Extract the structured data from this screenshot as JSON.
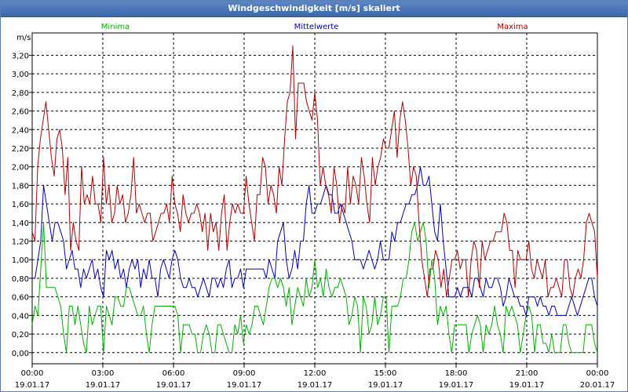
{
  "window": {
    "title": "Windgeschwindigkeit [m/s] skaliert"
  },
  "colors": {
    "minima": "#00b000",
    "mittel": "#0000b4",
    "maxima": "#b00000",
    "grid": "#000000"
  },
  "chart_data": {
    "type": "line",
    "title": "Windgeschwindigkeit [m/s] skaliert",
    "ylabel": "m/s",
    "ylim": [
      -0.12,
      3.44
    ],
    "xlim": [
      0,
      24
    ],
    "grid": true,
    "legend_placement": "top",
    "y_ticks": [
      "0,00",
      "0,20",
      "0,40",
      "0,60",
      "0,80",
      "1,00",
      "1,20",
      "1,40",
      "1,60",
      "1,80",
      "2,00",
      "2,20",
      "2,40",
      "2,60",
      "2,80",
      "3,00",
      "3,20"
    ],
    "x_ticks": [
      {
        "time": "00:00",
        "date": "19.01.17"
      },
      {
        "time": "03:00",
        "date": "19.01.17"
      },
      {
        "time": "06:00",
        "date": "19.01.17"
      },
      {
        "time": "09:00",
        "date": "19.01.17"
      },
      {
        "time": "12:00",
        "date": "19.01.17"
      },
      {
        "time": "15:00",
        "date": "19.01.17"
      },
      {
        "time": "18:00",
        "date": "19.01.17"
      },
      {
        "time": "21:00",
        "date": "19.01.17"
      },
      {
        "time": "00:00",
        "date": "20.01.17"
      }
    ],
    "x_hours_step": 0.16667,
    "series": [
      {
        "name": "Minima",
        "color": "#00b000",
        "values": [
          0.3,
          0.5,
          0.4,
          0.9,
          1.4,
          0.7,
          0.7,
          0.7,
          0.7,
          0.6,
          0.5,
          0.2,
          0.0,
          0.5,
          0.5,
          0.3,
          0.5,
          0.3,
          0.1,
          0.0,
          0.5,
          0.3,
          0.4,
          0.5,
          0.5,
          0.0,
          0.5,
          0.4,
          0.3,
          0.6,
          0.6,
          0.5,
          0.5,
          0.7,
          0.7,
          0.6,
          0.5,
          0.4,
          0.4,
          0.5,
          0.2,
          0.0,
          0.3,
          0.5,
          0.5,
          0.5,
          0.5,
          0.5,
          0.5,
          0.5,
          0.5,
          0.4,
          0.0,
          0.3,
          0.3,
          0.3,
          0.2,
          0.2,
          0.0,
          0.0,
          0.2,
          0.3,
          0.2,
          0.0,
          0.0,
          0.3,
          0.3,
          0.2,
          0.1,
          0.0,
          0.0,
          0.3,
          0.2,
          0.4,
          0.1,
          0.3,
          0.2,
          0.3,
          0.5,
          0.5,
          0.4,
          0.3,
          0.5,
          0.7,
          0.8,
          0.8,
          0.7,
          0.8,
          0.7,
          0.5,
          0.7,
          0.3,
          0.5,
          0.7,
          0.6,
          0.5,
          0.8,
          0.6,
          0.7,
          1.0,
          0.7,
          0.8,
          0.6,
          0.9,
          0.7,
          0.6,
          0.7,
          0.7,
          0.8,
          0.7,
          0.6,
          0.3,
          0.4,
          0.6,
          0.5,
          0.0,
          0.6,
          0.5,
          0.2,
          0.3,
          0.6,
          0.3,
          0.4,
          0.6,
          0.6,
          0.0,
          0.5,
          0.5,
          0.5,
          0.6,
          0.8,
          0.8,
          1.0,
          1.3,
          1.4,
          1.2,
          1.3,
          1.4,
          1.2,
          0.7,
          1.0,
          0.8,
          0.3,
          0.5,
          0.4,
          0.5,
          0.2,
          0.0,
          0.3,
          0.3,
          0.3,
          0.3,
          0.3,
          0.0,
          0.2,
          0.3,
          0.4,
          0.3,
          0.0,
          0.3,
          0.2,
          0.3,
          0.5,
          0.3,
          0.2,
          0.0,
          0.5,
          0.4,
          0.5,
          0.4,
          0.3,
          0.0,
          0.2,
          0.4,
          0.5,
          0.4,
          0.0,
          0.3,
          0.3,
          0.1,
          0.1,
          0.0,
          0.2,
          0.0,
          0.0,
          0.0,
          0.3,
          0.3,
          0.1,
          0.0,
          0.0,
          0.0,
          0.0,
          0.0,
          0.3,
          0.3,
          0.3,
          0.1,
          0.0
        ]
      },
      {
        "name": "Mittelwerte",
        "color": "#0000b4",
        "values": [
          0.8,
          0.8,
          1.0,
          1.2,
          1.8,
          1.6,
          1.4,
          1.2,
          1.4,
          1.4,
          1.3,
          1.2,
          0.9,
          1.0,
          1.1,
          0.9,
          0.9,
          0.7,
          0.9,
          0.8,
          0.9,
          1.0,
          0.8,
          0.9,
          0.7,
          0.6,
          1.1,
          1.0,
          1.1,
          0.9,
          1.0,
          0.8,
          0.9,
          0.7,
          0.9,
          1.0,
          0.9,
          1.0,
          0.7,
          0.9,
          0.8,
          1.0,
          0.8,
          0.8,
          0.6,
          0.9,
          1.0,
          0.9,
          0.8,
          1.0,
          1.1,
          1.0,
          0.8,
          0.7,
          0.7,
          0.8,
          0.7,
          0.7,
          0.6,
          0.7,
          0.8,
          0.7,
          0.6,
          0.8,
          0.8,
          0.7,
          0.8,
          0.7,
          0.9,
          1.0,
          0.7,
          0.8,
          0.8,
          0.9,
          0.7,
          0.9,
          0.9,
          0.9,
          0.9,
          0.9,
          0.9,
          0.9,
          0.8,
          1.0,
          0.9,
          0.8,
          1.2,
          1.3,
          1.4,
          1.0,
          0.8,
          0.9,
          1.1,
          0.9,
          1.2,
          1.2,
          1.6,
          1.8,
          1.5,
          1.5,
          1.6,
          1.6,
          1.7,
          1.8,
          1.7,
          1.7,
          1.5,
          1.5,
          1.6,
          1.5,
          1.4,
          1.3,
          1.2,
          1.0,
          1.0,
          1.0,
          0.9,
          1.0,
          1.1,
          1.0,
          0.9,
          1.0,
          1.2,
          1.0,
          1.0,
          1.0,
          1.3,
          1.2,
          1.4,
          1.4,
          1.5,
          1.6,
          1.6,
          1.7,
          1.7,
          1.8,
          2.0,
          1.8,
          1.8,
          1.9,
          1.6,
          1.3,
          1.2,
          1.6,
          1.2,
          0.9,
          0.6,
          0.6,
          0.6,
          0.7,
          0.6,
          0.7,
          0.7,
          0.7,
          0.6,
          0.8,
          0.8,
          0.7,
          0.6,
          0.8,
          0.7,
          0.7,
          0.8,
          0.8,
          0.7,
          0.5,
          0.6,
          0.8,
          0.7,
          0.6,
          0.6,
          0.5,
          0.5,
          0.4,
          0.6,
          0.6,
          0.6,
          0.5,
          0.6,
          0.5,
          0.5,
          0.4,
          0.5,
          0.5,
          0.4,
          0.4,
          0.4,
          0.4,
          0.5,
          0.6,
          0.5,
          0.4,
          0.5,
          0.6,
          0.7,
          0.8,
          0.8,
          0.6,
          0.5
        ]
      },
      {
        "name": "Maxima",
        "color": "#b00000",
        "values": [
          1.3,
          1.2,
          2.0,
          2.3,
          2.5,
          2.7,
          2.4,
          2.1,
          1.9,
          2.3,
          2.4,
          2.2,
          1.7,
          2.1,
          1.1,
          1.4,
          1.2,
          1.1,
          2.0,
          1.6,
          1.7,
          1.6,
          1.9,
          1.6,
          1.6,
          1.4,
          2.1,
          1.6,
          1.8,
          1.4,
          1.5,
          1.8,
          1.6,
          1.7,
          1.4,
          1.5,
          1.7,
          2.1,
          1.5,
          1.6,
          1.5,
          1.4,
          1.5,
          1.5,
          1.2,
          1.3,
          1.4,
          1.5,
          1.5,
          1.6,
          1.4,
          1.9,
          1.6,
          1.5,
          1.3,
          1.7,
          1.5,
          1.4,
          1.5,
          1.5,
          1.6,
          1.5,
          1.3,
          1.5,
          1.1,
          1.5,
          1.3,
          1.4,
          1.1,
          1.5,
          1.7,
          1.1,
          1.4,
          1.6,
          1.5,
          1.6,
          1.5,
          1.5,
          1.9,
          1.6,
          1.4,
          1.2,
          1.7,
          1.7,
          2.1,
          2.0,
          1.6,
          1.8,
          1.7,
          1.5,
          2.0,
          1.8,
          2.3,
          2.7,
          2.8,
          3.3,
          2.3,
          2.9,
          2.9,
          2.9,
          2.7,
          2.6,
          2.5,
          2.8,
          2.5,
          1.8,
          2.0,
          1.8,
          1.7,
          1.5,
          2.0,
          1.8,
          1.4,
          1.6,
          1.5,
          2.0,
          1.6,
          1.9,
          1.8,
          1.6,
          2.1,
          1.9,
          1.6,
          1.4,
          2.1,
          1.8,
          2.0,
          2.1,
          2.3,
          2.2,
          2.2,
          2.4,
          2.6,
          2.1,
          2.5,
          2.7,
          2.5,
          2.2,
          1.8,
          2.0,
          1.9,
          1.4,
          1.0,
          0.8,
          0.6,
          0.9,
          0.9,
          1.1,
          1.0,
          0.7,
          0.9,
          0.6,
          0.8,
          1.0,
          1.0,
          1.1,
          0.9,
          1.0,
          1.0,
          0.6,
          1.0,
          1.2,
          1.1,
          0.7,
          1.2,
          1.0,
          1.1,
          1.2,
          1.2,
          1.3,
          1.3,
          1.3,
          1.5,
          1.4,
          1.1,
          1.1,
          0.7,
          1.1,
          1.0,
          1.0,
          1.0,
          1.2,
          0.9,
          0.8,
          1.0,
          0.9,
          0.8,
          1.0,
          0.6,
          0.7,
          0.7,
          0.8,
          0.7,
          0.6,
          1.0,
          1.0,
          0.7,
          0.6,
          0.8,
          0.9,
          0.8,
          1.0,
          1.4,
          1.5,
          1.4,
          1.3,
          0.8
        ]
      }
    ]
  }
}
